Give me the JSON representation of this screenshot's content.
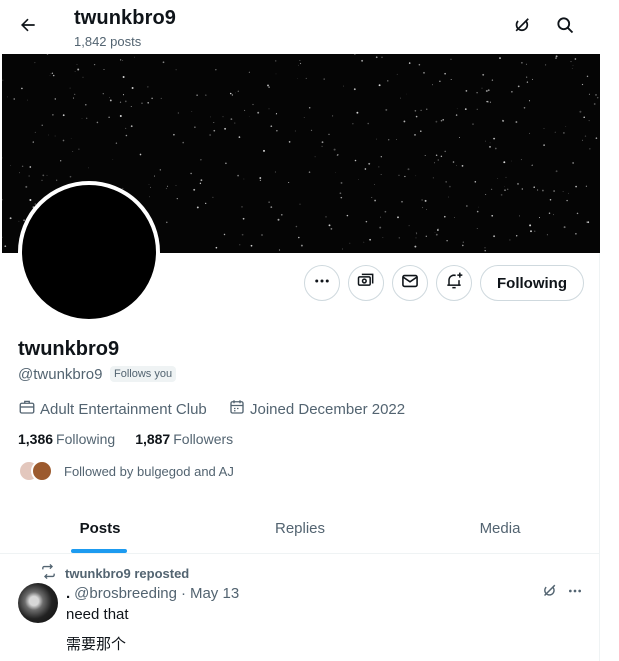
{
  "header": {
    "name": "twunkbro9",
    "posts_count": "1,842 posts"
  },
  "profile": {
    "display_name": "twunkbro9",
    "handle": "@twunkbro9",
    "follows_you": "Follows you",
    "category": "Adult Entertainment Club",
    "joined": "Joined December 2022",
    "following_count": "1,386",
    "following_label": "Following",
    "followers_count": "1,887",
    "followers_label": "Followers",
    "followed_by": "Followed by bulgegod and AJ"
  },
  "actions": {
    "following_button": "Following"
  },
  "tabs": [
    {
      "label": "Posts",
      "active": true
    },
    {
      "label": "Replies",
      "active": false
    },
    {
      "label": "Media",
      "active": false
    }
  ],
  "post": {
    "reposted_by": "twunkbro9 reposted",
    "author_name": ".",
    "author_handle": "@brosbreeding",
    "separator": "·",
    "date": "May 13",
    "lines": [
      "need that",
      "需要那个"
    ]
  },
  "icons": {
    "back": "arrow-left-icon",
    "top_right_1": "grok-icon",
    "top_right_2": "search-icon",
    "more": "more-dots-icon",
    "subscribe": "money-icon",
    "message": "mail-icon",
    "notifications": "bell-plus-icon",
    "category": "briefcase-icon",
    "joined": "calendar-icon",
    "repost": "repost-icon",
    "post_grok": "grok-icon",
    "post_more": "more-dots-icon"
  },
  "colors": {
    "accent": "#1d9bf0",
    "text": "#0f1419",
    "muted": "#536471",
    "border": "#cfd9de"
  }
}
